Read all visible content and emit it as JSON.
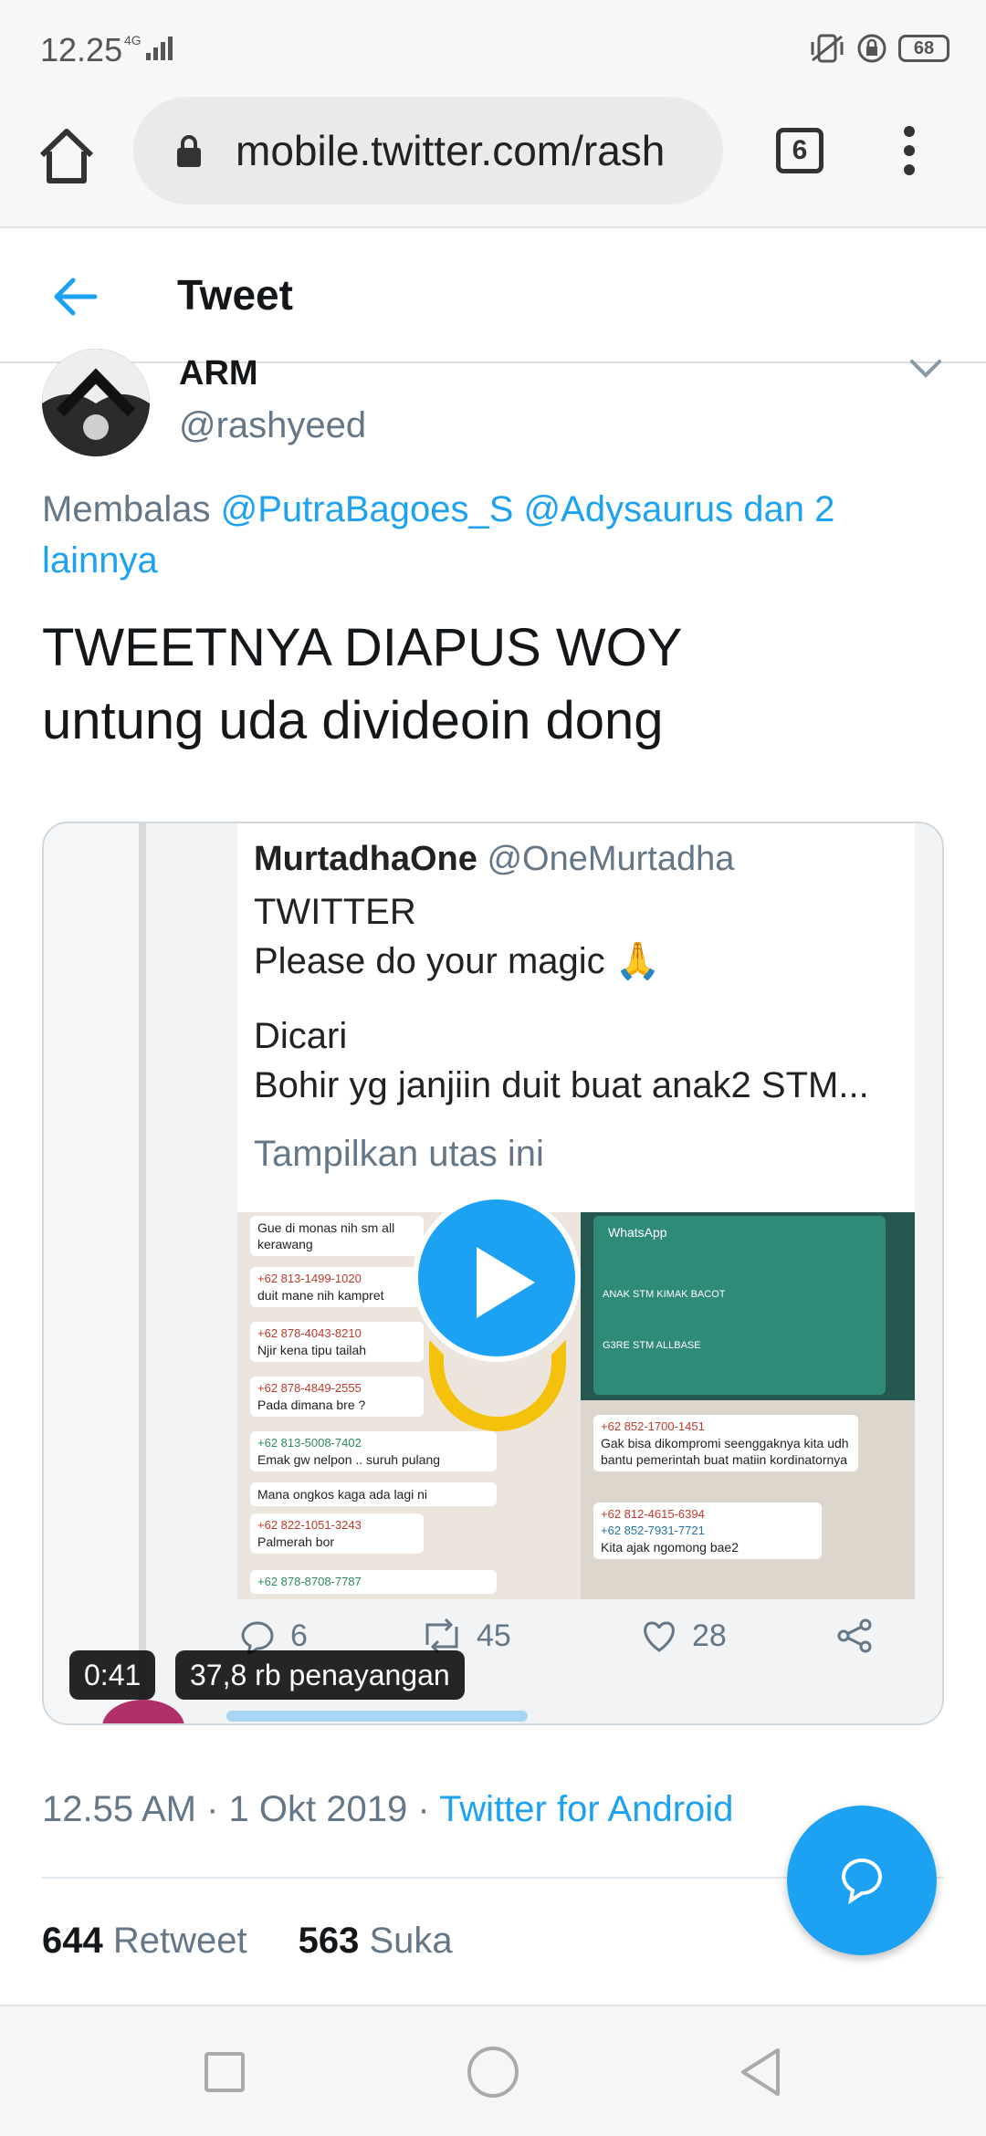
{
  "status_bar": {
    "time": "12.25",
    "network": "4G",
    "battery": "68"
  },
  "browser": {
    "url": "mobile.twitter.com/rash",
    "tab_count": "6"
  },
  "header": {
    "title": "Tweet"
  },
  "tweet": {
    "author_name": "ARM",
    "author_handle": "@rashyeed",
    "reply_prefix": "Membalas",
    "reply_mentions": "@PutraBagoes_S @Adysaurus dan 2 lainnya",
    "text_line1": "TWEETNYA DIAPUS WOY",
    "text_line2": "untung uda divideoin dong",
    "timestamp": "12.55 AM · 1 Okt 2019 · ",
    "source": "Twitter for Android",
    "retweet_count": "644",
    "retweet_label": "Retweet",
    "like_count": "563",
    "like_label": "Suka"
  },
  "media": {
    "inner_name": "MurtadhaOne",
    "inner_handle": "@OneMurtadha",
    "inner_line1": "TWITTER",
    "inner_line2": "Please do your magic 🙏",
    "inner_line3": "Dicari",
    "inner_line4": "Bohir yg janjiin duit buat anak2 STM...",
    "inner_thread": "Tampilkan utas ini",
    "inner_replies": "6",
    "inner_retweets": "45",
    "inner_likes": "28",
    "duration": "0:41",
    "views": "37,8 rb penayangan",
    "chat": {
      "b1": "Gue di monas nih sm all kerawang",
      "b2_num": "+62 813-1499-1020",
      "b2": "duit mane nih kampret",
      "b3_num": "+62 878-4043-8210",
      "b3": "Njir kena tipu tailah",
      "b4_num": "+62 878-4849-2555",
      "b4": "Pada dimana bre ?",
      "b5_num": "+62 813-5008-7402",
      "b5": "Emak gw nelpon .. suruh pulang",
      "b6": "Mana ongkos kaga ada lagi ni",
      "b7_num": "+62 822-1051-3243",
      "b7": "Palmerah bor",
      "b8_num": "+62 878-8708-7787",
      "r_title": "WhatsApp",
      "r_row1": "ANAK STM KIMAK BACOT",
      "r_row2": "G3RE STM ALLBASE",
      "r_b1_num": "+62 852-1700-1451",
      "r_b1": "Gak bisa dikompromi seenggaknya kita udh bantu pemerintah buat matiin kordinatornya",
      "r_b2_num": "+62 812-4615-6394",
      "r_b3_num": "+62 852-7931-7721",
      "r_b3": "Kita ajak ngomong bae2"
    }
  },
  "colors": {
    "accent": "#1da1f2",
    "secondary_text": "#657786",
    "primary_text": "#14171a"
  },
  "icons": [
    "home-icon",
    "lock-icon",
    "tabs-icon",
    "more-vert-icon",
    "back-arrow-icon",
    "chevron-down-icon",
    "play-icon",
    "reply-icon",
    "retweet-icon",
    "like-icon",
    "share-icon",
    "compose-icon"
  ]
}
